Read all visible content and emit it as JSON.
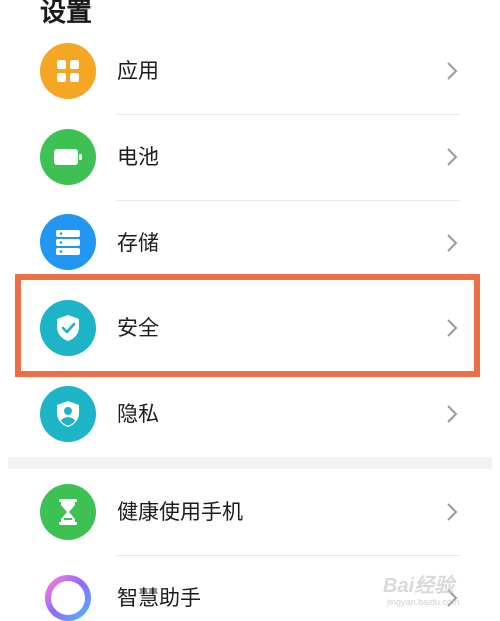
{
  "header": {
    "title": "设置"
  },
  "items": [
    {
      "label": "应用",
      "icon": "apps-grid-icon",
      "color": "#f5a623"
    },
    {
      "label": "电池",
      "icon": "battery-icon",
      "color": "#3ec153"
    },
    {
      "label": "存储",
      "icon": "storage-icon",
      "color": "#2196f3"
    },
    {
      "label": "安全",
      "icon": "shield-check-icon",
      "color": "#1cb4c6"
    },
    {
      "label": "隐私",
      "icon": "privacy-shield-icon",
      "color": "#1cb4c6"
    },
    {
      "label": "健康使用手机",
      "icon": "hourglass-icon",
      "color": "#3ec153"
    },
    {
      "label": "智慧助手",
      "icon": "assistant-ring-icon",
      "color": "#a878ff"
    }
  ],
  "highlight": {
    "color": "#ec6e45",
    "target": "安全"
  },
  "watermark": {
    "text": "Bai经验",
    "sub": "jingyan.baidu.com"
  }
}
